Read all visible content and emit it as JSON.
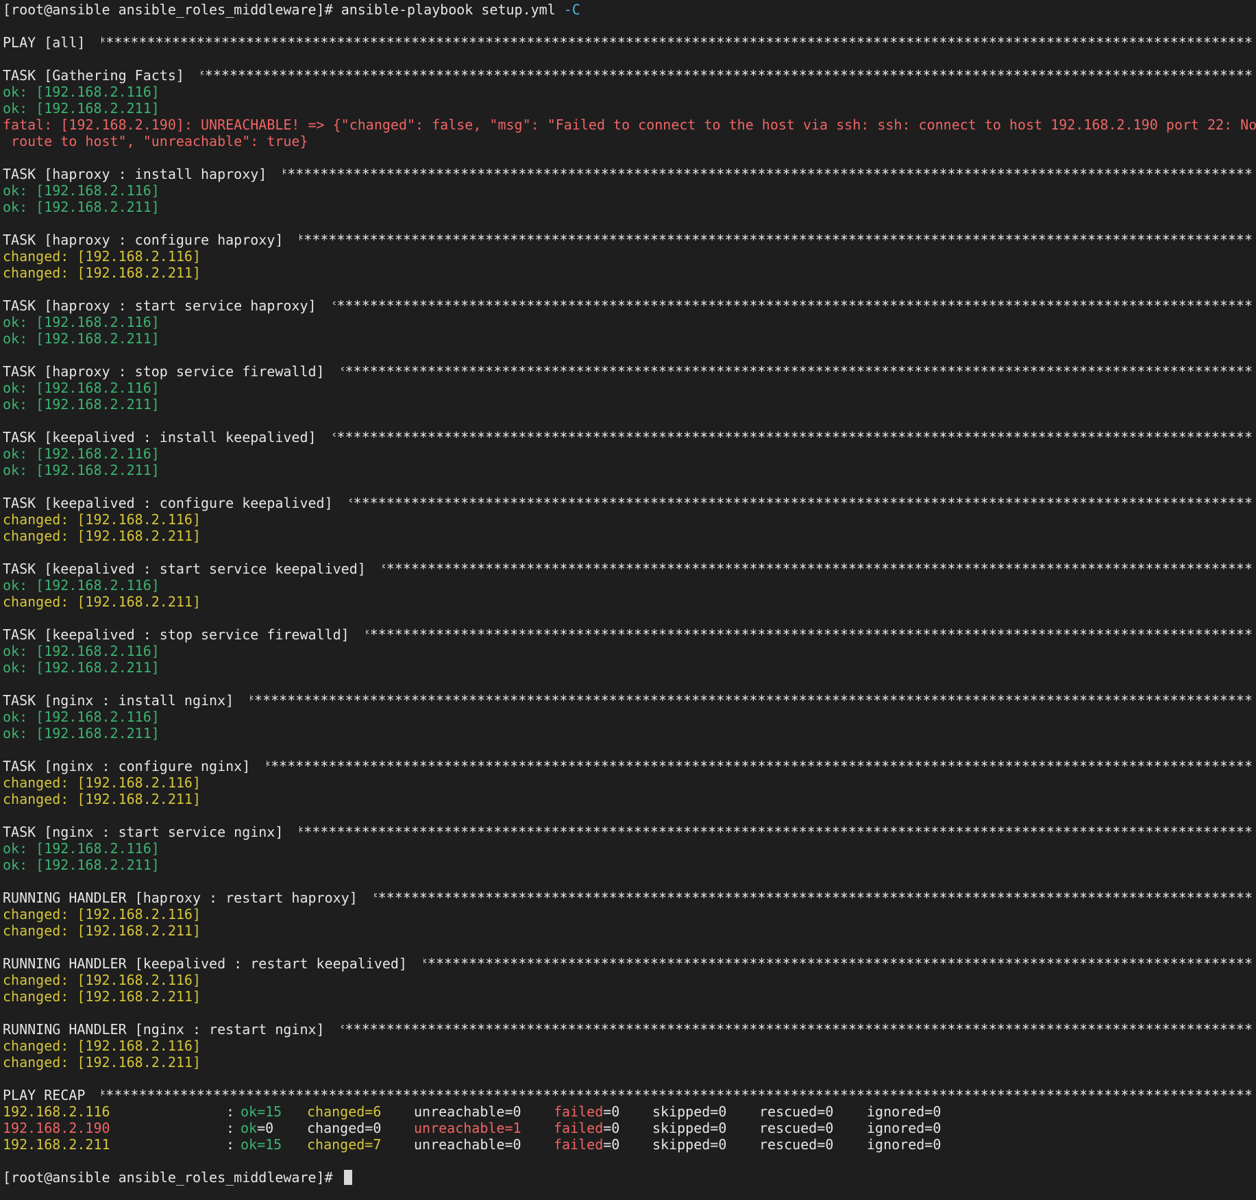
{
  "terminal": {
    "prompt": "[root@ansible ansible_roles_middleware]# ",
    "command_main": "ansible-playbook setup.yml ",
    "command_flag": "-C",
    "stars": "****************************************************************************************************************************************************************************************",
    "play_header": "PLAY [all] ",
    "sections": [
      {
        "header": "TASK [Gathering Facts] ",
        "lines": [
          {
            "text": "ok: [192.168.2.116]",
            "status": "ok"
          },
          {
            "text": "ok: [192.168.2.211]",
            "status": "ok"
          },
          {
            "text": "fatal: [192.168.2.190]: UNREACHABLE! => {\"changed\": false, \"msg\": \"Failed to connect to the host via ssh: ssh: connect to host 192.168.2.190 port 22: No",
            "status": "fatal"
          },
          {
            "text": " route to host\", \"unreachable\": true}",
            "status": "fatal"
          }
        ]
      },
      {
        "header": "TASK [haproxy : install haproxy] ",
        "lines": [
          {
            "text": "ok: [192.168.2.116]",
            "status": "ok"
          },
          {
            "text": "ok: [192.168.2.211]",
            "status": "ok"
          }
        ]
      },
      {
        "header": "TASK [haproxy : configure haproxy] ",
        "lines": [
          {
            "text": "changed: [192.168.2.116]",
            "status": "changed"
          },
          {
            "text": "changed: [192.168.2.211]",
            "status": "changed"
          }
        ]
      },
      {
        "header": "TASK [haproxy : start service haproxy] ",
        "lines": [
          {
            "text": "ok: [192.168.2.116]",
            "status": "ok"
          },
          {
            "text": "ok: [192.168.2.211]",
            "status": "ok"
          }
        ]
      },
      {
        "header": "TASK [haproxy : stop service firewalld] ",
        "lines": [
          {
            "text": "ok: [192.168.2.116]",
            "status": "ok"
          },
          {
            "text": "ok: [192.168.2.211]",
            "status": "ok"
          }
        ]
      },
      {
        "header": "TASK [keepalived : install keepalived] ",
        "lines": [
          {
            "text": "ok: [192.168.2.116]",
            "status": "ok"
          },
          {
            "text": "ok: [192.168.2.211]",
            "status": "ok"
          }
        ]
      },
      {
        "header": "TASK [keepalived : configure keepalived] ",
        "lines": [
          {
            "text": "changed: [192.168.2.116]",
            "status": "changed"
          },
          {
            "text": "changed: [192.168.2.211]",
            "status": "changed"
          }
        ]
      },
      {
        "header": "TASK [keepalived : start service keepalived] ",
        "lines": [
          {
            "text": "ok: [192.168.2.116]",
            "status": "ok"
          },
          {
            "text": "changed: [192.168.2.211]",
            "status": "changed"
          }
        ]
      },
      {
        "header": "TASK [keepalived : stop service firewalld] ",
        "lines": [
          {
            "text": "ok: [192.168.2.116]",
            "status": "ok"
          },
          {
            "text": "ok: [192.168.2.211]",
            "status": "ok"
          }
        ]
      },
      {
        "header": "TASK [nginx : install nginx] ",
        "lines": [
          {
            "text": "ok: [192.168.2.116]",
            "status": "ok"
          },
          {
            "text": "ok: [192.168.2.211]",
            "status": "ok"
          }
        ]
      },
      {
        "header": "TASK [nginx : configure nginx] ",
        "lines": [
          {
            "text": "changed: [192.168.2.116]",
            "status": "changed"
          },
          {
            "text": "changed: [192.168.2.211]",
            "status": "changed"
          }
        ]
      },
      {
        "header": "TASK [nginx : start service nginx] ",
        "lines": [
          {
            "text": "ok: [192.168.2.116]",
            "status": "ok"
          },
          {
            "text": "ok: [192.168.2.211]",
            "status": "ok"
          }
        ]
      },
      {
        "header": "RUNNING HANDLER [haproxy : restart haproxy] ",
        "lines": [
          {
            "text": "changed: [192.168.2.116]",
            "status": "changed"
          },
          {
            "text": "changed: [192.168.2.211]",
            "status": "changed"
          }
        ]
      },
      {
        "header": "RUNNING HANDLER [keepalived : restart keepalived] ",
        "lines": [
          {
            "text": "changed: [192.168.2.116]",
            "status": "changed"
          },
          {
            "text": "changed: [192.168.2.211]",
            "status": "changed"
          }
        ]
      },
      {
        "header": "RUNNING HANDLER [nginx : restart nginx] ",
        "lines": [
          {
            "text": "changed: [192.168.2.116]",
            "status": "changed"
          },
          {
            "text": "changed: [192.168.2.211]",
            "status": "changed"
          }
        ]
      }
    ],
    "recap_header": "PLAY RECAP ",
    "recap": [
      {
        "host": "192.168.2.116",
        "host_status": "changed",
        "colon": ":",
        "ok": "ok=15",
        "ok_status": "ok",
        "changed": "changed=6",
        "changed_status": "changed",
        "unreachable": "unreachable=0",
        "unreachable_status": "plain",
        "failed_key": "failed",
        "failed_val": "=0",
        "skipped": "skipped=0",
        "rescued": "rescued=0",
        "ignored": "ignored=0"
      },
      {
        "host": "192.168.2.190",
        "host_status": "fatal",
        "colon": ":",
        "ok_key": "ok",
        "ok_val": "=0",
        "ok": "ok=0",
        "ok_status": "split",
        "changed": "changed=0",
        "changed_status": "plain",
        "unreachable": "unreachable=1",
        "unreachable_status": "fatal",
        "failed_key": "failed",
        "failed_val": "=0",
        "skipped": "skipped=0",
        "rescued": "rescued=0",
        "ignored": "ignored=0"
      },
      {
        "host": "192.168.2.211",
        "host_status": "changed",
        "colon": ":",
        "ok": "ok=15",
        "ok_status": "ok",
        "changed": "changed=7",
        "changed_status": "changed",
        "unreachable": "unreachable=0",
        "unreachable_status": "plain",
        "failed_key": "failed",
        "failed_val": "=0",
        "skipped": "skipped=0",
        "rescued": "rescued=0",
        "ignored": "ignored=0"
      }
    ],
    "colors": {
      "background": "#1e1e1e",
      "text": "#e6e6e6",
      "ok": "#3cb371",
      "changed": "#d7c63a",
      "fatal": "#f06464",
      "flag": "#4fb8d8"
    }
  }
}
